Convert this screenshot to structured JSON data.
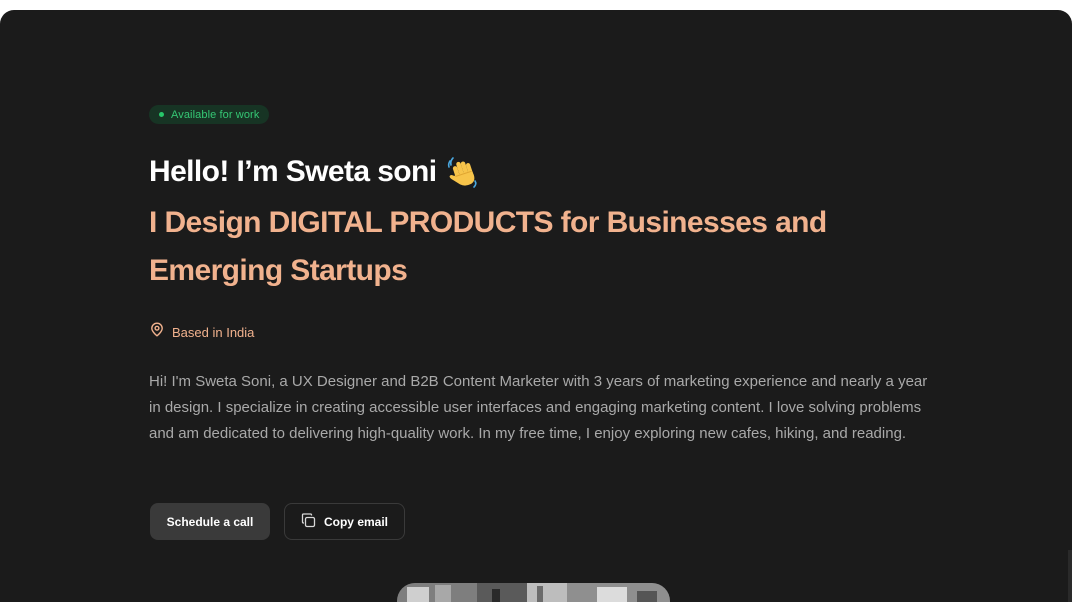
{
  "hero": {
    "availability_badge": "Available for work",
    "greeting": "Hello! I’m Sweta soni",
    "greeting_emoji": "waving-hand-icon",
    "tagline": "I Design DIGITAL PRODUCTS for Businesses and Emerging Startups",
    "location_icon": "map-pin-icon",
    "location": "Based in India",
    "bio": "Hi! I'm Sweta Soni, a UX Designer and B2B Content Marketer with 3 years of marketing experience and nearly a year in design. I specialize in creating accessible user interfaces and engaging marketing content. I love solving problems and am dedicated to delivering high-quality work. In my free time, I enjoy exploring new cafes, hiking, and reading."
  },
  "actions": {
    "schedule_label": "Schedule a call",
    "copy_email_label": "Copy email",
    "copy_icon": "copy-icon"
  },
  "colors": {
    "background": "#1b1b1b",
    "accent": "#f1b28e",
    "available_green": "#35c774",
    "badge_bg": "#173424",
    "body_text": "#a9a9a9",
    "button_bg": "#3a3a3a"
  }
}
